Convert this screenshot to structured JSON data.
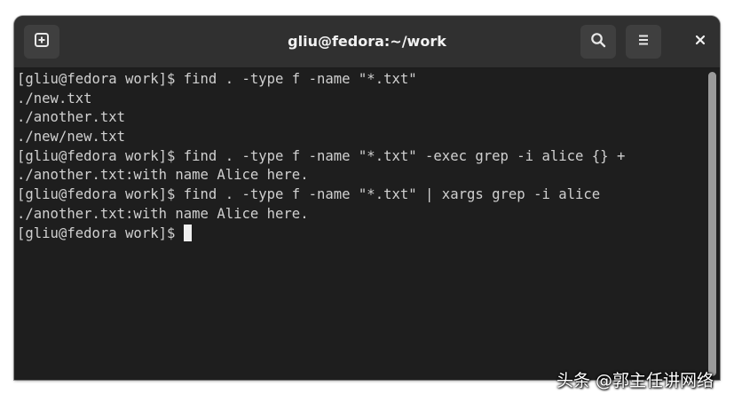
{
  "window": {
    "title": "gliu@fedora:~/work"
  },
  "headerbar": {
    "new_tab_icon": "new-tab-icon",
    "search_icon": "search-icon",
    "menu_icon": "hamburger-menu-icon",
    "close_icon": "close-icon"
  },
  "terminal": {
    "lines": [
      "[gliu@fedora work]$ find . -type f -name \"*.txt\"",
      "./new.txt",
      "./another.txt",
      "./new/new.txt",
      "[gliu@fedora work]$ find . -type f -name \"*.txt\" -exec grep -i alice {} +",
      "./another.txt:with name Alice here.",
      "[gliu@fedora work]$ find . -type f -name \"*.txt\" | xargs grep -i alice",
      "./another.txt:with name Alice here."
    ],
    "prompt": "[gliu@fedora work]$ ",
    "colors": {
      "background": "#1e1e1e",
      "foreground": "#d0d0d0",
      "cursor": "#f0f0f0"
    }
  },
  "watermark": {
    "text": "头条 @郭主任讲网络"
  }
}
